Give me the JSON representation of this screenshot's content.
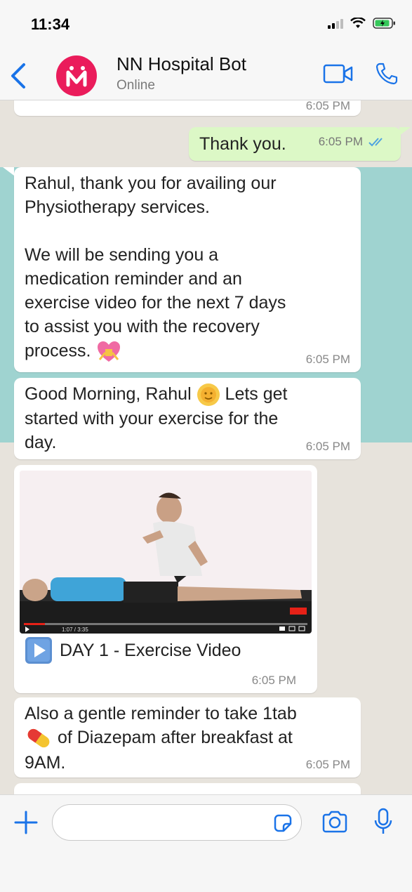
{
  "status": {
    "time": "11:34"
  },
  "header": {
    "title": "NN Hospital Bot",
    "subtitle": "Online"
  },
  "messages": {
    "top_partial_ts": "6:05 PM",
    "thank_you": {
      "text": "Thank you.",
      "ts": "6:05 PM"
    },
    "physio": {
      "text": "Rahul, thank you for availing our\nPhysiotherapy services.\n\nWe will be sending you a\nmedication reminder and an\nexercise video for the next 7 days\nto assist you with the recovery\nprocess.",
      "ts": "6:05 PM"
    },
    "morning": {
      "line1": "Good Morning, Rahul",
      "line1b": " Lets get",
      "rest": "started with your exercise for the\nday.",
      "ts": "6:05 PM"
    },
    "video": {
      "caption": "DAY 1 - Exercise Video",
      "ts": "6:05 PM",
      "player_time": "1:07 / 3:35"
    },
    "reminder": {
      "line1": "Also a gentle reminder to take 1tab",
      "line2": " of Diazepam after breakfast at",
      "line3": "9AM.",
      "ts": "6:05 PM"
    }
  },
  "input": {
    "placeholder": ""
  },
  "colors": {
    "accent": "#1a73e8",
    "bot_brand": "#ea1c5b",
    "outgoing": "#dcf8c6",
    "highlight": "#9fd3d0"
  }
}
